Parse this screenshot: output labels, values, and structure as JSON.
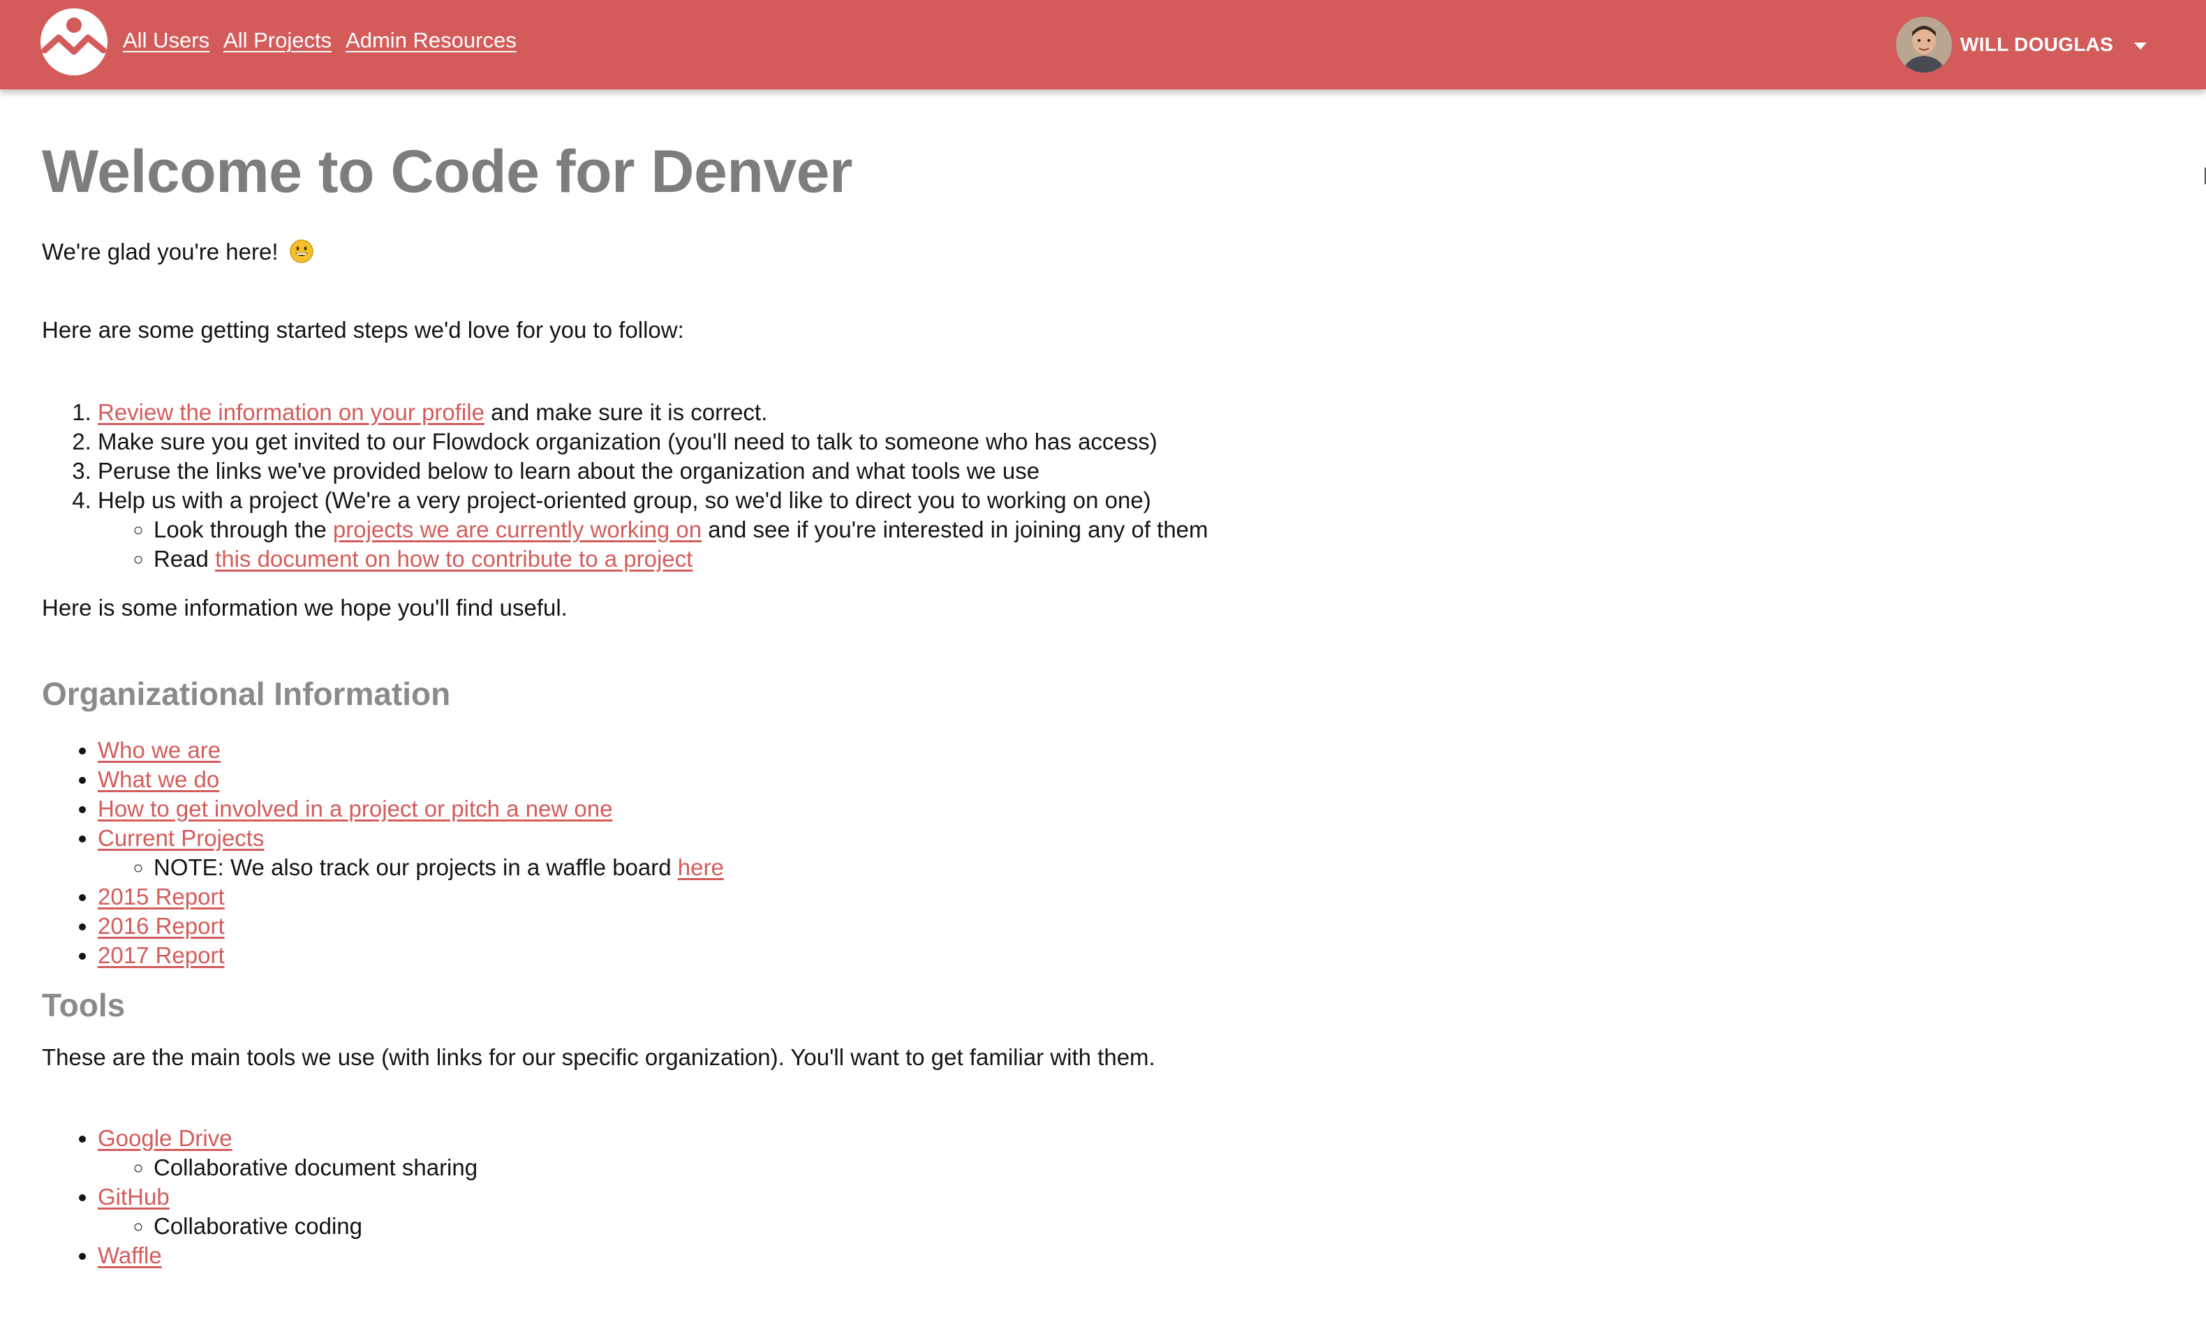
{
  "header": {
    "nav": [
      {
        "label": "All Users"
      },
      {
        "label": "All Projects"
      },
      {
        "label": "Admin Resources"
      }
    ],
    "user": {
      "name": "WILL DOUGLAS"
    },
    "colors": {
      "brand": "#d35c5b",
      "text": "#ffffff"
    }
  },
  "main": {
    "title": "Welcome to Code for Denver",
    "greeting": "We're glad you're here!",
    "greeting_emoji": "grinning-face-emoji",
    "intro": "Here are some getting started steps we'd love for you to follow:",
    "steps": [
      {
        "link": "Review the information on your profile",
        "text": " and make sure it is correct."
      },
      {
        "text": "Make sure you get invited to our Flowdock organization (you'll need to talk to someone who has access)"
      },
      {
        "text": "Peruse the links we've provided below to learn about the organization and what tools we use"
      },
      {
        "text": "Help us with a project (We're a very project-oriented group, so we'd like to direct you to working on one)"
      }
    ],
    "step4_sub": [
      {
        "pre": "Look through the ",
        "link": "projects we are currently working on",
        "post": " and see if you're interested in joining any of them"
      },
      {
        "pre": "Read ",
        "link": "this document on how to contribute to a project"
      }
    ],
    "info_intro": "Here is some information we hope you'll find useful.",
    "org": {
      "heading": "Organizational Information",
      "links": [
        "Who we are",
        "What we do",
        "How to get involved in a project or pitch a new one",
        "Current Projects"
      ],
      "note_pre": "NOTE: We also track our projects in a waffle board ",
      "note_link": "here",
      "reports": [
        "2015 Report",
        "2016 Report",
        "2017 Report"
      ]
    },
    "tools": {
      "heading": "Tools",
      "intro": "These are the main tools we use (with links for our specific organization). You'll want to get familiar with them.",
      "items": [
        {
          "name": "Google Drive",
          "desc": "Collaborative document sharing"
        },
        {
          "name": "GitHub",
          "desc": "Collaborative coding"
        },
        {
          "name": "Waffle"
        }
      ]
    },
    "link_color": "#d35c5b",
    "heading_color": "#7d7d7d"
  }
}
